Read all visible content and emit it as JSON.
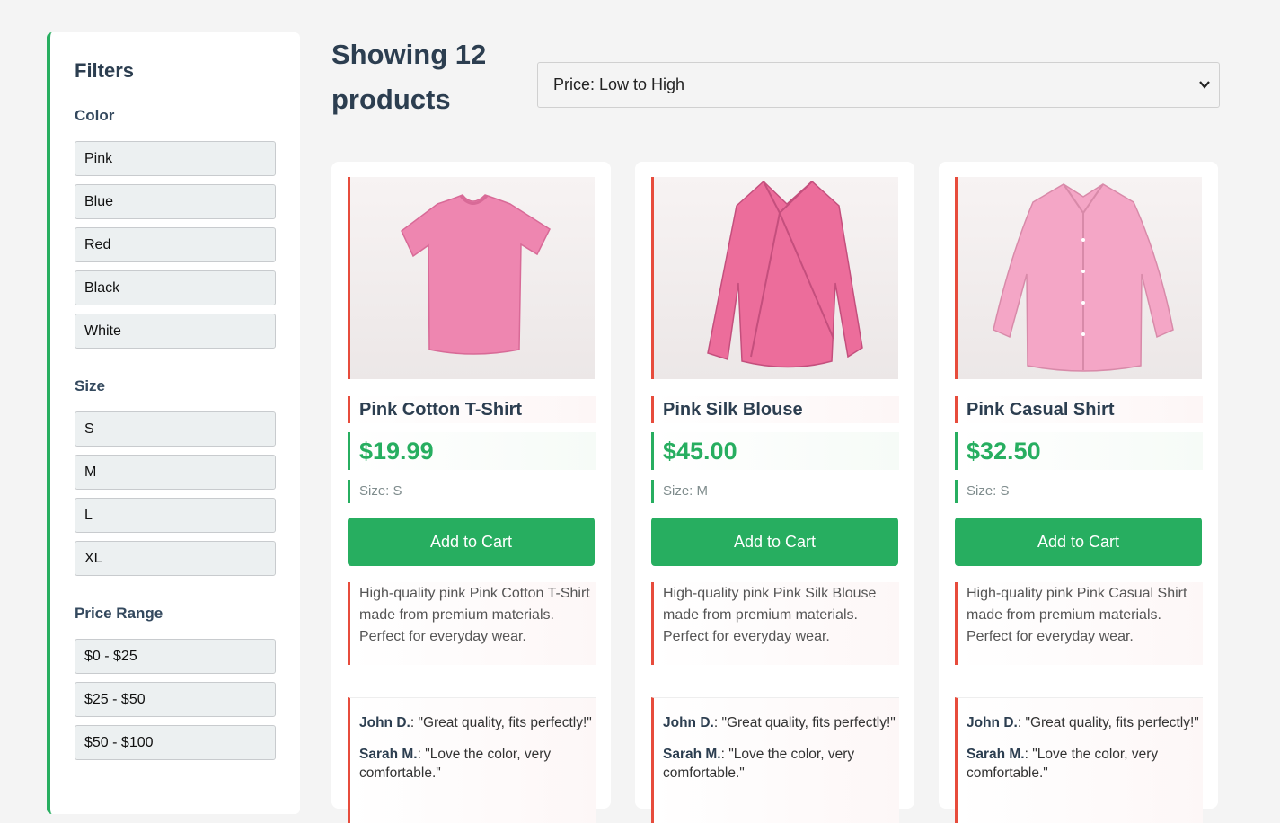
{
  "filters": {
    "title": "Filters",
    "color": {
      "label": "Color",
      "options": [
        "Pink",
        "Blue",
        "Red",
        "Black",
        "White"
      ]
    },
    "size": {
      "label": "Size",
      "options": [
        "S",
        "M",
        "L",
        "XL"
      ]
    },
    "price": {
      "label": "Price Range",
      "options": [
        "$0 - $25",
        "$25 - $50",
        "$50 - $100"
      ]
    }
  },
  "results": {
    "title": "Showing 12 products",
    "sort_value": "Price: Low to High"
  },
  "colors": {
    "accent_green": "#27ae60",
    "accent_red": "#e74c3c",
    "product_pink": "#ef87b0"
  },
  "products": [
    {
      "name": "Pink Cotton T-Shirt",
      "price": "$19.99",
      "size": "Size: S",
      "cta": "Add to Cart",
      "description": "High-quality pink Pink Cotton T-Shirt made from premium materials. Perfect for everyday wear.",
      "image_icon": "t-shirt-icon",
      "reviews": [
        {
          "author": "John D.",
          "text": ": \"Great quality, fits perfectly!\""
        },
        {
          "author": "Sarah M.",
          "text": ": \"Love the color, very comfortable.\""
        }
      ]
    },
    {
      "name": "Pink Silk Blouse",
      "price": "$45.00",
      "size": "Size: M",
      "cta": "Add to Cart",
      "description": "High-quality pink Pink Silk Blouse made from premium materials. Perfect for everyday wear.",
      "image_icon": "blouse-icon",
      "reviews": [
        {
          "author": "John D.",
          "text": ": \"Great quality, fits perfectly!\""
        },
        {
          "author": "Sarah M.",
          "text": ": \"Love the color, very comfortable.\""
        }
      ]
    },
    {
      "name": "Pink Casual Shirt",
      "price": "$32.50",
      "size": "Size: S",
      "cta": "Add to Cart",
      "description": "High-quality pink Pink Casual Shirt made from premium materials. Perfect for everyday wear.",
      "image_icon": "shirt-icon",
      "reviews": [
        {
          "author": "John D.",
          "text": ": \"Great quality, fits perfectly!\""
        },
        {
          "author": "Sarah M.",
          "text": ": \"Love the color, very comfortable.\""
        }
      ]
    }
  ]
}
